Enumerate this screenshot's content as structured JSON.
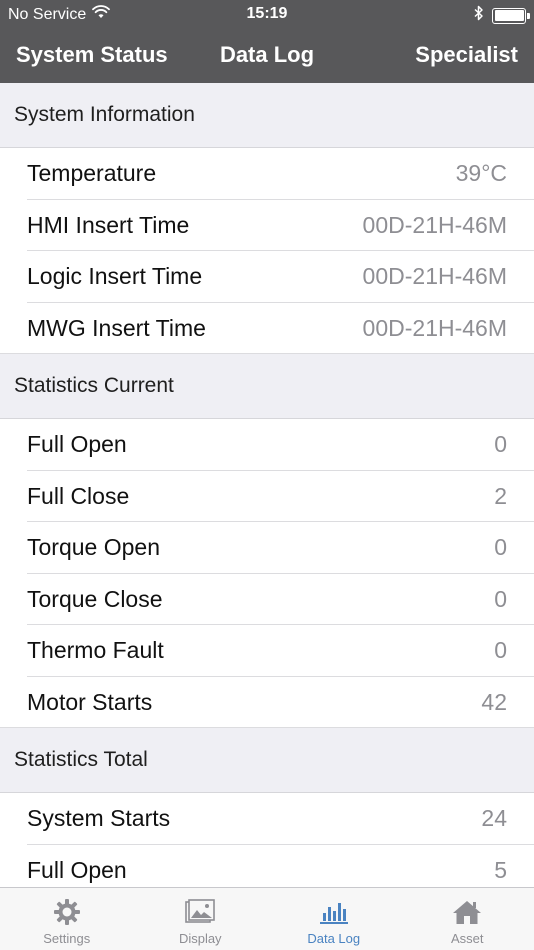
{
  "status_bar": {
    "carrier": "No Service",
    "time": "15:19"
  },
  "nav": {
    "left": "System Status",
    "title": "Data Log",
    "right": "Specialist"
  },
  "sections": [
    {
      "title": "System Information",
      "rows": [
        {
          "label": "Temperature",
          "value": "39°C"
        },
        {
          "label": "HMI Insert Time",
          "value": "00D-21H-46M"
        },
        {
          "label": "Logic Insert Time",
          "value": "00D-21H-46M"
        },
        {
          "label": "MWG Insert Time",
          "value": "00D-21H-46M"
        }
      ]
    },
    {
      "title": "Statistics Current",
      "rows": [
        {
          "label": "Full Open",
          "value": "0"
        },
        {
          "label": "Full Close",
          "value": "2"
        },
        {
          "label": "Torque Open",
          "value": "0"
        },
        {
          "label": "Torque Close",
          "value": "0"
        },
        {
          "label": "Thermo Fault",
          "value": "0"
        },
        {
          "label": "Motor Starts",
          "value": "42"
        }
      ]
    },
    {
      "title": "Statistics Total",
      "rows": [
        {
          "label": "System Starts",
          "value": "24"
        },
        {
          "label": "Full Open",
          "value": "5"
        }
      ]
    }
  ],
  "tabbar": {
    "tabs": [
      {
        "label": "Settings",
        "icon": "gear-icon",
        "active": false
      },
      {
        "label": "Display",
        "icon": "image-icon",
        "active": false
      },
      {
        "label": "Data Log",
        "icon": "bar-chart-icon",
        "active": true
      },
      {
        "label": "Asset",
        "icon": "home-icon",
        "active": false
      }
    ]
  },
  "colors": {
    "header_bg": "#58585a",
    "section_bg": "#efeff4",
    "value_text": "#8e8e93",
    "active_tab": "#4a83c1",
    "inactive_tab": "#8e8e93"
  }
}
